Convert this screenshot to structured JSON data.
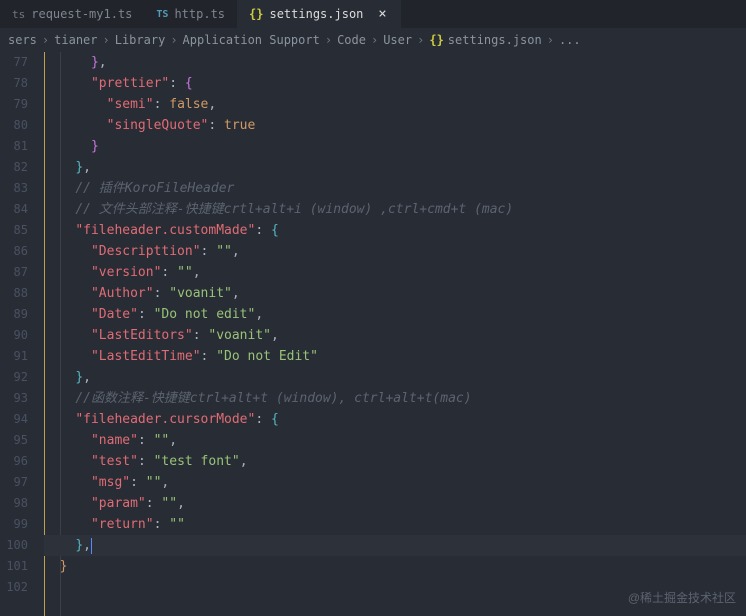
{
  "tabs": [
    {
      "label": "request-my1.ts",
      "icon": "ts",
      "active": false
    },
    {
      "label": "http.ts",
      "icon": "TS",
      "active": false
    },
    {
      "label": "settings.json",
      "icon": "{}",
      "active": true
    }
  ],
  "breadcrumbs": {
    "parts": [
      "sers",
      "tianer",
      "Library",
      "Application Support",
      "Code",
      "User"
    ],
    "file": "settings.json",
    "tail": "..."
  },
  "line_start": 77,
  "code": [
    {
      "i": 3,
      "t": [
        [
          "brace2",
          "}"
        ],
        [
          "punct",
          ","
        ]
      ]
    },
    {
      "i": 3,
      "t": [
        [
          "key",
          "\"prettier\""
        ],
        [
          "punct",
          ": "
        ],
        [
          "brace2",
          "{"
        ]
      ]
    },
    {
      "i": 4,
      "t": [
        [
          "key",
          "\"semi\""
        ],
        [
          "punct",
          ": "
        ],
        [
          "bool",
          "false"
        ],
        [
          "punct",
          ","
        ]
      ]
    },
    {
      "i": 4,
      "t": [
        [
          "key",
          "\"singleQuote\""
        ],
        [
          "punct",
          ": "
        ],
        [
          "bool",
          "true"
        ]
      ]
    },
    {
      "i": 3,
      "t": [
        [
          "brace2",
          "}"
        ]
      ]
    },
    {
      "i": 2,
      "t": [
        [
          "brace3",
          "}"
        ],
        [
          "punct",
          ","
        ]
      ]
    },
    {
      "i": 2,
      "t": [
        [
          "comment",
          "// 插件KoroFileHeader"
        ]
      ]
    },
    {
      "i": 2,
      "t": [
        [
          "comment",
          "// 文件头部注释-快捷键crtl+alt+i (window) ,ctrl+cmd+t (mac)"
        ]
      ]
    },
    {
      "i": 2,
      "t": [
        [
          "key",
          "\"fileheader.customMade\""
        ],
        [
          "punct",
          ": "
        ],
        [
          "brace3",
          "{"
        ]
      ]
    },
    {
      "i": 3,
      "t": [
        [
          "key",
          "\"Descripttion\""
        ],
        [
          "punct",
          ": "
        ],
        [
          "str",
          "\"\""
        ],
        [
          "punct",
          ","
        ]
      ]
    },
    {
      "i": 3,
      "t": [
        [
          "key",
          "\"version\""
        ],
        [
          "punct",
          ": "
        ],
        [
          "str",
          "\"\""
        ],
        [
          "punct",
          ","
        ]
      ]
    },
    {
      "i": 3,
      "t": [
        [
          "key",
          "\"Author\""
        ],
        [
          "punct",
          ": "
        ],
        [
          "str",
          "\"voanit\""
        ],
        [
          "punct",
          ","
        ]
      ]
    },
    {
      "i": 3,
      "t": [
        [
          "key",
          "\"Date\""
        ],
        [
          "punct",
          ": "
        ],
        [
          "str",
          "\"Do not edit\""
        ],
        [
          "punct",
          ","
        ]
      ]
    },
    {
      "i": 3,
      "t": [
        [
          "key",
          "\"LastEditors\""
        ],
        [
          "punct",
          ": "
        ],
        [
          "str",
          "\"voanit\""
        ],
        [
          "punct",
          ","
        ]
      ]
    },
    {
      "i": 3,
      "t": [
        [
          "key",
          "\"LastEditTime\""
        ],
        [
          "punct",
          ": "
        ],
        [
          "str",
          "\"Do not Edit\""
        ]
      ]
    },
    {
      "i": 2,
      "t": [
        [
          "brace3",
          "}"
        ],
        [
          "punct",
          ","
        ]
      ]
    },
    {
      "i": 2,
      "t": [
        [
          "comment",
          "//函数注释-快捷键ctrl+alt+t (window), ctrl+alt+t(mac)"
        ]
      ]
    },
    {
      "i": 2,
      "t": [
        [
          "key",
          "\"fileheader.cursorMode\""
        ],
        [
          "punct",
          ": "
        ],
        [
          "brace3",
          "{"
        ]
      ]
    },
    {
      "i": 3,
      "t": [
        [
          "key",
          "\"name\""
        ],
        [
          "punct",
          ": "
        ],
        [
          "str",
          "\"\""
        ],
        [
          "punct",
          ","
        ]
      ]
    },
    {
      "i": 3,
      "t": [
        [
          "key",
          "\"test\""
        ],
        [
          "punct",
          ": "
        ],
        [
          "str",
          "\"test font\""
        ],
        [
          "punct",
          ","
        ]
      ]
    },
    {
      "i": 3,
      "t": [
        [
          "key",
          "\"msg\""
        ],
        [
          "punct",
          ": "
        ],
        [
          "str",
          "\"\""
        ],
        [
          "punct",
          ","
        ]
      ]
    },
    {
      "i": 3,
      "t": [
        [
          "key",
          "\"param\""
        ],
        [
          "punct",
          ": "
        ],
        [
          "str",
          "\"\""
        ],
        [
          "punct",
          ","
        ]
      ]
    },
    {
      "i": 3,
      "t": [
        [
          "key",
          "\"return\""
        ],
        [
          "punct",
          ": "
        ],
        [
          "str",
          "\"\""
        ]
      ]
    },
    {
      "i": 2,
      "t": [
        [
          "brace3",
          "}"
        ],
        [
          "punct",
          ","
        ]
      ],
      "current": true
    },
    {
      "i": 1,
      "t": [
        [
          "brace",
          "}"
        ]
      ]
    },
    {
      "i": 0,
      "t": []
    }
  ],
  "watermark": "@稀土掘金技术社区"
}
